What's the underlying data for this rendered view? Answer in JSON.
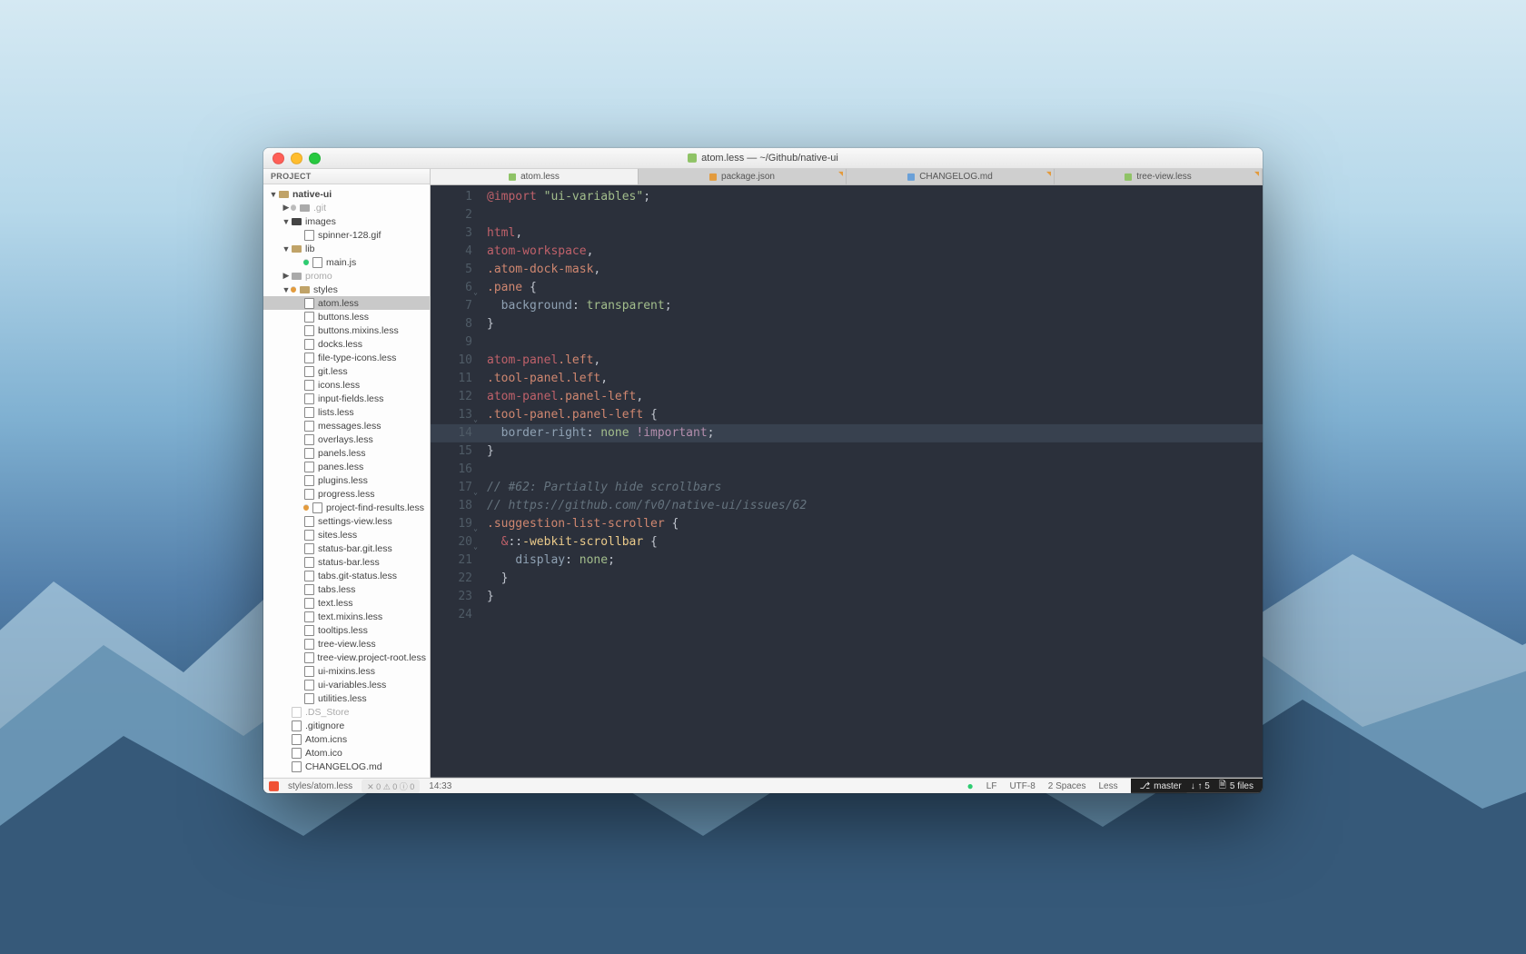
{
  "window": {
    "title": "atom.less — ~/Github/native-ui"
  },
  "sidebar": {
    "header": "PROJECT",
    "root": "native-ui",
    "tree": [
      {
        "depth": 0,
        "type": "folder-root",
        "label": "native-ui",
        "caret": "down",
        "bold": true
      },
      {
        "depth": 1,
        "type": "folder",
        "label": ".git",
        "caret": "right",
        "dim": true,
        "status": "dim"
      },
      {
        "depth": 1,
        "type": "folder",
        "label": "images",
        "caret": "down",
        "dark": true
      },
      {
        "depth": 2,
        "type": "file",
        "label": "spinner-128.gif"
      },
      {
        "depth": 1,
        "type": "folder",
        "label": "lib",
        "caret": "down"
      },
      {
        "depth": 2,
        "type": "file",
        "label": "main.js",
        "status": "green"
      },
      {
        "depth": 1,
        "type": "folder",
        "label": "promo",
        "caret": "right",
        "dim": true
      },
      {
        "depth": 1,
        "type": "folder",
        "label": "styles",
        "caret": "down",
        "status": "orange"
      },
      {
        "depth": 2,
        "type": "file",
        "label": "atom.less",
        "active": true
      },
      {
        "depth": 2,
        "type": "file",
        "label": "buttons.less"
      },
      {
        "depth": 2,
        "type": "file",
        "label": "buttons.mixins.less"
      },
      {
        "depth": 2,
        "type": "file",
        "label": "docks.less"
      },
      {
        "depth": 2,
        "type": "file",
        "label": "file-type-icons.less"
      },
      {
        "depth": 2,
        "type": "file",
        "label": "git.less"
      },
      {
        "depth": 2,
        "type": "file",
        "label": "icons.less"
      },
      {
        "depth": 2,
        "type": "file",
        "label": "input-fields.less"
      },
      {
        "depth": 2,
        "type": "file",
        "label": "lists.less"
      },
      {
        "depth": 2,
        "type": "file",
        "label": "messages.less"
      },
      {
        "depth": 2,
        "type": "file",
        "label": "overlays.less"
      },
      {
        "depth": 2,
        "type": "file",
        "label": "panels.less"
      },
      {
        "depth": 2,
        "type": "file",
        "label": "panes.less"
      },
      {
        "depth": 2,
        "type": "file",
        "label": "plugins.less"
      },
      {
        "depth": 2,
        "type": "file",
        "label": "progress.less"
      },
      {
        "depth": 2,
        "type": "file",
        "label": "project-find-results.less",
        "status": "orange"
      },
      {
        "depth": 2,
        "type": "file",
        "label": "settings-view.less"
      },
      {
        "depth": 2,
        "type": "file",
        "label": "sites.less"
      },
      {
        "depth": 2,
        "type": "file",
        "label": "status-bar.git.less"
      },
      {
        "depth": 2,
        "type": "file",
        "label": "status-bar.less"
      },
      {
        "depth": 2,
        "type": "file",
        "label": "tabs.git-status.less"
      },
      {
        "depth": 2,
        "type": "file",
        "label": "tabs.less"
      },
      {
        "depth": 2,
        "type": "file",
        "label": "text.less"
      },
      {
        "depth": 2,
        "type": "file",
        "label": "text.mixins.less"
      },
      {
        "depth": 2,
        "type": "file",
        "label": "tooltips.less"
      },
      {
        "depth": 2,
        "type": "file",
        "label": "tree-view.less"
      },
      {
        "depth": 2,
        "type": "file",
        "label": "tree-view.project-root.less"
      },
      {
        "depth": 2,
        "type": "file",
        "label": "ui-mixins.less"
      },
      {
        "depth": 2,
        "type": "file",
        "label": "ui-variables.less"
      },
      {
        "depth": 2,
        "type": "file",
        "label": "utilities.less"
      },
      {
        "depth": 1,
        "type": "file",
        "label": ".DS_Store",
        "dim": true
      },
      {
        "depth": 1,
        "type": "file",
        "label": ".gitignore"
      },
      {
        "depth": 1,
        "type": "file",
        "label": "Atom.icns"
      },
      {
        "depth": 1,
        "type": "file",
        "label": "Atom.ico"
      },
      {
        "depth": 1,
        "type": "file",
        "label": "CHANGELOG.md",
        "cut": true
      }
    ]
  },
  "tabs": [
    {
      "label": "atom.less",
      "active": true,
      "icon": "less"
    },
    {
      "label": "package.json",
      "icon": "json",
      "modified": true
    },
    {
      "label": "CHANGELOG.md",
      "icon": "md",
      "modified": true
    },
    {
      "label": "tree-view.less",
      "icon": "less",
      "modified": true
    }
  ],
  "editor": {
    "highlight_line": 14,
    "lines": [
      {
        "n": 1,
        "tokens": [
          [
            "@import",
            "sy-keyword"
          ],
          [
            " ",
            "sy-punct"
          ],
          [
            "\"ui-variables\"",
            "sy-string"
          ],
          [
            ";",
            "sy-punct"
          ]
        ]
      },
      {
        "n": 2,
        "tokens": []
      },
      {
        "n": 3,
        "tokens": [
          [
            "html",
            "sy-tag"
          ],
          [
            ",",
            "sy-punct"
          ]
        ]
      },
      {
        "n": 4,
        "tokens": [
          [
            "atom-workspace",
            "sy-tag"
          ],
          [
            ",",
            "sy-punct"
          ]
        ]
      },
      {
        "n": 5,
        "tokens": [
          [
            ".atom-dock-mask",
            "sy-class"
          ],
          [
            ",",
            "sy-punct"
          ]
        ]
      },
      {
        "n": 6,
        "fold": true,
        "tokens": [
          [
            ".pane",
            "sy-class"
          ],
          [
            " {",
            "sy-punct"
          ]
        ]
      },
      {
        "n": 7,
        "tokens": [
          [
            "  ",
            "sy-punct"
          ],
          [
            "background",
            "sy-prop"
          ],
          [
            ":",
            "sy-punct"
          ],
          [
            " ",
            "sy-punct"
          ],
          [
            "transparent",
            "sy-value"
          ],
          [
            ";",
            "sy-punct"
          ]
        ]
      },
      {
        "n": 8,
        "tokens": [
          [
            "}",
            "sy-punct"
          ]
        ]
      },
      {
        "n": 9,
        "tokens": []
      },
      {
        "n": 10,
        "tokens": [
          [
            "atom-panel",
            "sy-tag"
          ],
          [
            ".left",
            "sy-class"
          ],
          [
            ",",
            "sy-punct"
          ]
        ]
      },
      {
        "n": 11,
        "tokens": [
          [
            ".tool-panel",
            "sy-class"
          ],
          [
            ".left",
            "sy-class"
          ],
          [
            ",",
            "sy-punct"
          ]
        ]
      },
      {
        "n": 12,
        "tokens": [
          [
            "atom-panel",
            "sy-tag"
          ],
          [
            ".panel-left",
            "sy-class"
          ],
          [
            ",",
            "sy-punct"
          ]
        ]
      },
      {
        "n": 13,
        "fold": true,
        "tokens": [
          [
            ".tool-panel",
            "sy-class"
          ],
          [
            ".panel-left",
            "sy-class"
          ],
          [
            " {",
            "sy-punct"
          ]
        ]
      },
      {
        "n": 14,
        "tokens": [
          [
            "  ",
            "sy-punct"
          ],
          [
            "border-right",
            "sy-prop"
          ],
          [
            ":",
            "sy-punct"
          ],
          [
            " ",
            "sy-punct"
          ],
          [
            "none",
            "sy-value"
          ],
          [
            " ",
            "sy-punct"
          ],
          [
            "!important",
            "sy-special"
          ],
          [
            ";",
            "sy-punct"
          ]
        ]
      },
      {
        "n": 15,
        "tokens": [
          [
            "}",
            "sy-punct"
          ]
        ]
      },
      {
        "n": 16,
        "tokens": []
      },
      {
        "n": 17,
        "fold": true,
        "tokens": [
          [
            "// #62: Partially hide scrollbars",
            "sy-comment"
          ]
        ]
      },
      {
        "n": 18,
        "tokens": [
          [
            "// https://github.com/fv0/native-ui/issues/62",
            "sy-comment"
          ]
        ]
      },
      {
        "n": 19,
        "fold": true,
        "tokens": [
          [
            ".suggestion-list-scroller",
            "sy-class"
          ],
          [
            " {",
            "sy-punct"
          ]
        ]
      },
      {
        "n": 20,
        "fold": true,
        "tokens": [
          [
            "  ",
            "sy-punct"
          ],
          [
            "&",
            "sy-amp"
          ],
          [
            "::",
            "sy-punct"
          ],
          [
            "-webkit-scrollbar",
            "sy-pseudo"
          ],
          [
            " {",
            "sy-punct"
          ]
        ]
      },
      {
        "n": 21,
        "tokens": [
          [
            "    ",
            "sy-punct"
          ],
          [
            "display",
            "sy-prop"
          ],
          [
            ":",
            "sy-punct"
          ],
          [
            " ",
            "sy-punct"
          ],
          [
            "none",
            "sy-value"
          ],
          [
            ";",
            "sy-punct"
          ]
        ]
      },
      {
        "n": 22,
        "tokens": [
          [
            "  }",
            "sy-punct"
          ]
        ]
      },
      {
        "n": 23,
        "tokens": [
          [
            "}",
            "sy-punct"
          ]
        ]
      },
      {
        "n": 24,
        "tokens": []
      }
    ]
  },
  "status": {
    "filepath": "styles/atom.less",
    "linter": "✕ 0  ⚠ 0  ⓘ 0",
    "cursor": "14:33",
    "lineending": "LF",
    "encoding": "UTF-8",
    "indent": "2 Spaces",
    "grammar": "Less",
    "branch": "master",
    "git_changes": "↓ ↑ 5",
    "git_files": "5 files"
  }
}
